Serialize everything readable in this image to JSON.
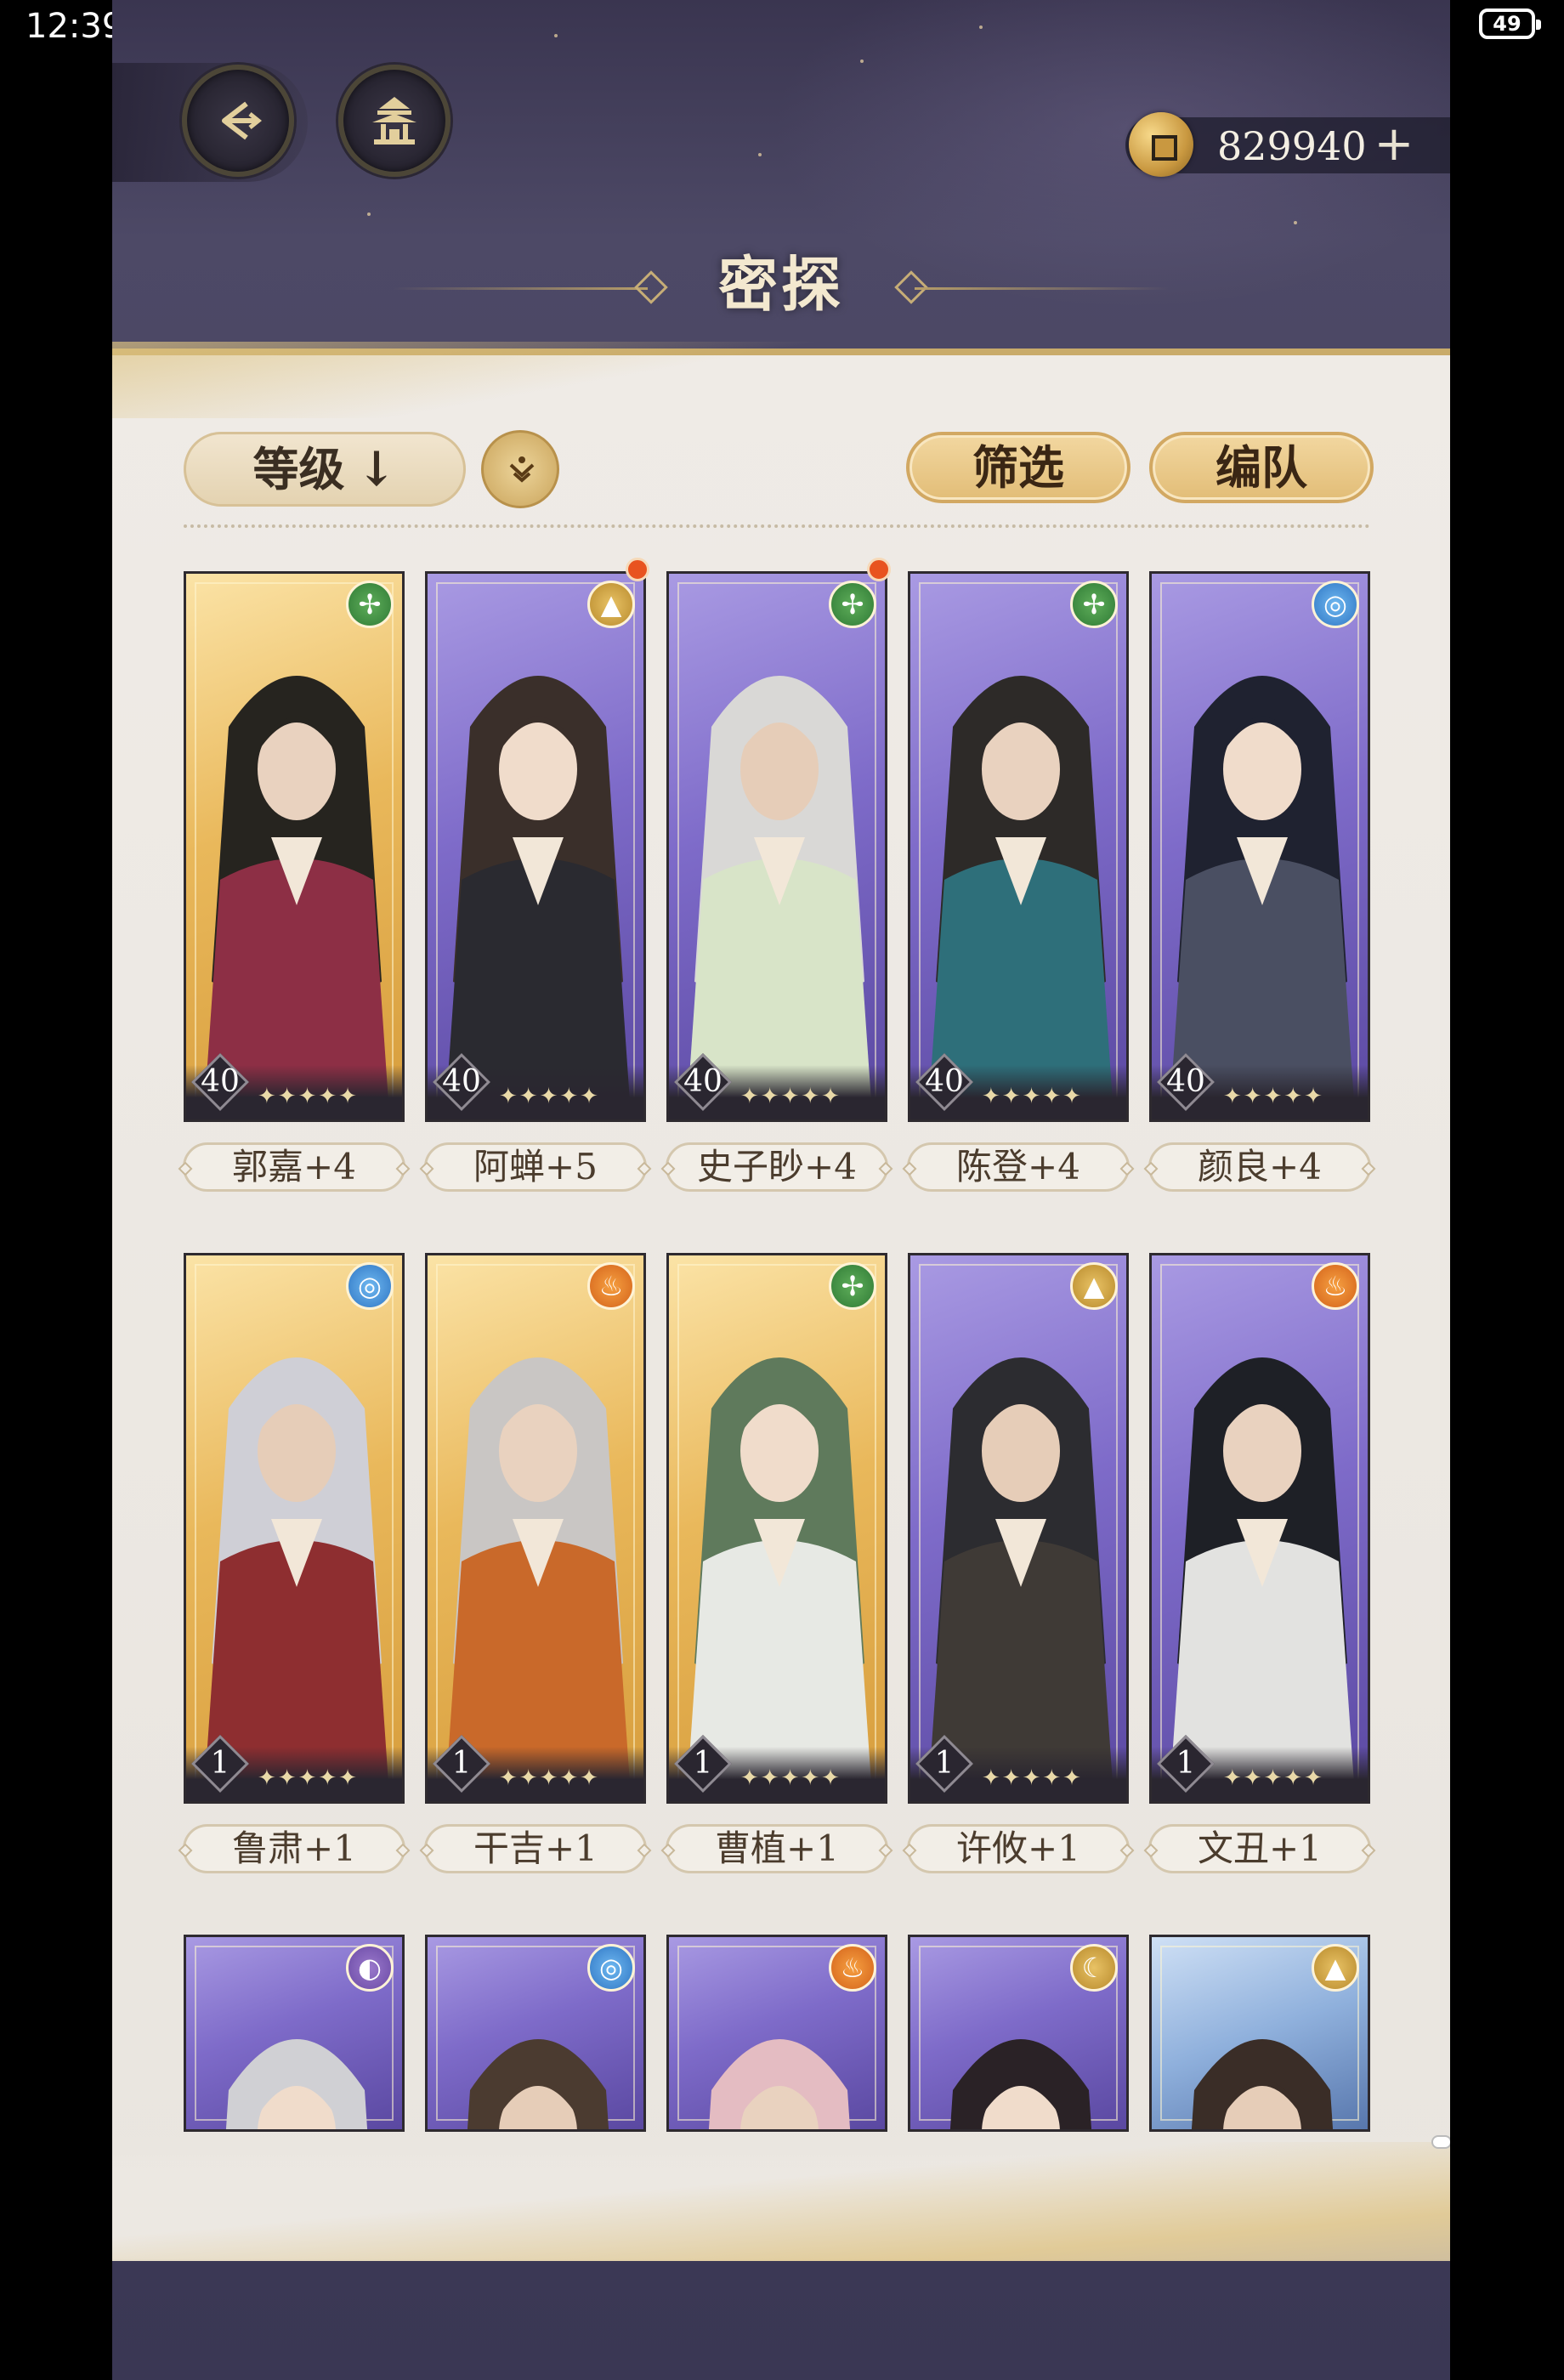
{
  "status_bar": {
    "time": "12:39",
    "battery": "49"
  },
  "header": {
    "back_icon": "back-arrow-icon",
    "home_icon": "pavilion-icon",
    "currency": {
      "icon": "coin-icon",
      "amount": "829940",
      "add_label": "+"
    },
    "title": "密探"
  },
  "toolbar": {
    "sort_label": "等级",
    "sort_arrow": "↓",
    "order_icon": "sort-order-icon",
    "filter_label": "筛选",
    "team_label": "编队"
  },
  "colors": {
    "accent_gold": "#e2bd77",
    "panel_bg": "#efebe6",
    "badge_red": "#e8531f"
  },
  "characters": [
    {
      "name": "郭嘉+4",
      "level": "40",
      "stars": 5,
      "element": "wind",
      "frame": "gold",
      "has_badge": false
    },
    {
      "name": "阿蝉+5",
      "level": "40",
      "stars": 5,
      "element": "earth",
      "frame": "purple",
      "has_badge": true
    },
    {
      "name": "史子眇+4",
      "level": "40",
      "stars": 5,
      "element": "wind",
      "frame": "purple",
      "has_badge": true
    },
    {
      "name": "陈登+4",
      "level": "40",
      "stars": 5,
      "element": "wind",
      "frame": "purple",
      "has_badge": false
    },
    {
      "name": "颜良+4",
      "level": "40",
      "stars": 5,
      "element": "water",
      "frame": "purple",
      "has_badge": false
    },
    {
      "name": "鲁肃+1",
      "level": "1",
      "stars": 5,
      "element": "water",
      "frame": "gold",
      "has_badge": false
    },
    {
      "name": "干吉+1",
      "level": "1",
      "stars": 5,
      "element": "fire",
      "frame": "gold",
      "has_badge": false
    },
    {
      "name": "曹植+1",
      "level": "1",
      "stars": 5,
      "element": "wind",
      "frame": "gold",
      "has_badge": false
    },
    {
      "name": "许攸+1",
      "level": "1",
      "stars": 5,
      "element": "earth",
      "frame": "purple",
      "has_badge": false
    },
    {
      "name": "文丑+1",
      "level": "1",
      "stars": 5,
      "element": "fire",
      "frame": "purple",
      "has_badge": false
    },
    {
      "name": "",
      "level": "",
      "stars": 0,
      "element": "void",
      "frame": "purple",
      "has_badge": false
    },
    {
      "name": "",
      "level": "",
      "stars": 0,
      "element": "water",
      "frame": "purple",
      "has_badge": false
    },
    {
      "name": "",
      "level": "",
      "stars": 0,
      "element": "fire",
      "frame": "purple",
      "has_badge": false
    },
    {
      "name": "",
      "level": "",
      "stars": 0,
      "element": "moon",
      "frame": "purple",
      "has_badge": false
    },
    {
      "name": "",
      "level": "",
      "stars": 0,
      "element": "earth",
      "frame": "blue",
      "has_badge": false
    }
  ]
}
